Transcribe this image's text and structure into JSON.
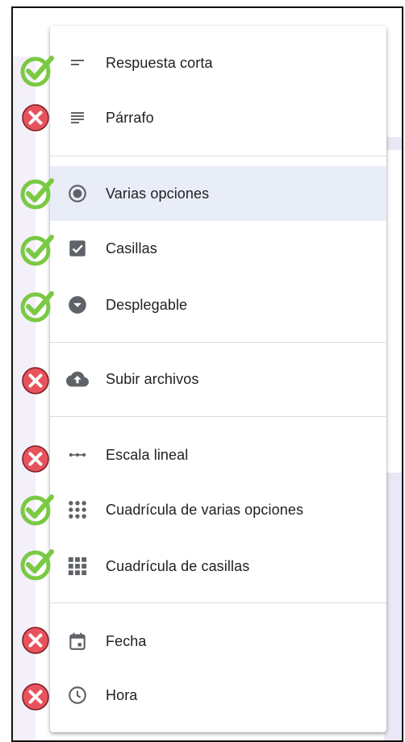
{
  "menu": {
    "items": [
      {
        "label": "Respuesta corta",
        "icon": "short-text-icon",
        "status": "check"
      },
      {
        "label": "Párrafo",
        "icon": "paragraph-icon",
        "status": "cross"
      },
      {
        "label": "Varias opciones",
        "icon": "radio-button-icon",
        "status": "check",
        "selected": true
      },
      {
        "label": "Casillas",
        "icon": "checkbox-icon",
        "status": "check"
      },
      {
        "label": "Desplegable",
        "icon": "dropdown-icon",
        "status": "check"
      },
      {
        "label": "Subir archivos",
        "icon": "cloud-upload-icon",
        "status": "cross"
      },
      {
        "label": "Escala lineal",
        "icon": "linear-scale-icon",
        "status": "cross"
      },
      {
        "label": "Cuadrícula de varias opciones",
        "icon": "multiple-choice-grid-icon",
        "status": "check"
      },
      {
        "label": "Cuadrícula de casillas",
        "icon": "checkbox-grid-icon",
        "status": "check"
      },
      {
        "label": "Fecha",
        "icon": "calendar-icon",
        "status": "cross"
      },
      {
        "label": "Hora",
        "icon": "clock-icon",
        "status": "cross"
      }
    ]
  },
  "colors": {
    "check": "#7ac943",
    "cross": "#e8525c",
    "icon": "#5f6368",
    "selected_bg": "#e8edf8"
  }
}
